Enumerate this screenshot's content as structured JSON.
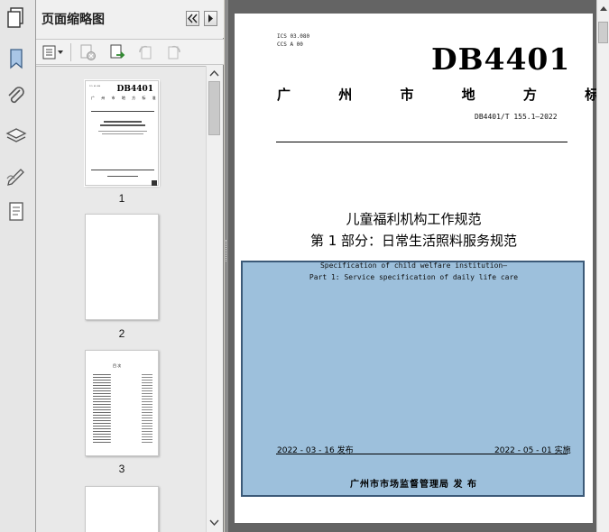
{
  "window": {
    "pane_title": "页面缩略图"
  },
  "sidebar_icons": [
    "bookmark-icon",
    "attachment-icon",
    "layers-icon",
    "signature-icon",
    "content-icon"
  ],
  "thumbnails": {
    "pages": [
      {
        "number": "1",
        "mini_title": "DB4401",
        "mini_subtitle": "广 州 市 地 方 标 准"
      },
      {
        "number": "2"
      },
      {
        "number": "3",
        "mini_heading": "目 次"
      }
    ]
  },
  "document": {
    "ics": "ICS 03.080",
    "ccs": "CCS A 00",
    "code_big": "DB4401",
    "std_type": "广 州 市 地 方 标 准",
    "std_number": "DB4401/T 155.1—2022",
    "title_line1": "儿童福利机构工作规范",
    "title_line2": "第 1 部分：日常生活照料服务规范",
    "en_line1": "Specification of child welfare institution—",
    "en_line2": "Part 1: Service specification of daily life care",
    "issue_date": "2022 - 03 - 16 发布",
    "impl_date": "2022 - 05 - 01 实施",
    "issuer": "广州市市场监督管理局   发 布"
  },
  "colors": {
    "highlight_fill": "#9dc0dc",
    "highlight_border": "#3c5a78"
  }
}
